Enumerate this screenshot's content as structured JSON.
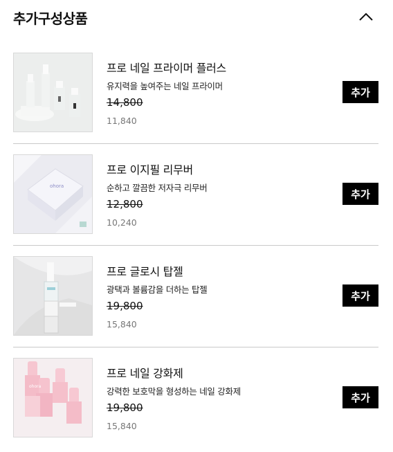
{
  "header": {
    "title": "추가구성상품",
    "toggle_icon": "chevron-up-icon"
  },
  "products": [
    {
      "name": "프로 네일 프라이머 플러스",
      "desc": "유지력을 높여주는 네일 프라이머",
      "original_price": "14,800",
      "sale_price": "11,840",
      "add_label": "추가",
      "image_tone": "#e9ebea"
    },
    {
      "name": "프로 이지필 리무버",
      "desc": "순하고 깔끔한 저자극 리무버",
      "original_price": "12,800",
      "sale_price": "10,240",
      "add_label": "추가",
      "image_tone": "#e6e6ee",
      "image_text": "ohora"
    },
    {
      "name": "프로 글로시 탑젤",
      "desc": "광택과 볼륨감을 더하는 탑젤",
      "original_price": "19,800",
      "sale_price": "15,840",
      "add_label": "추가",
      "image_tone": "#e3e3e4"
    },
    {
      "name": "프로 네일 강화제",
      "desc": "강력한 보호막을 형성하는 네일 강화제",
      "original_price": "19,800",
      "sale_price": "15,840",
      "add_label": "추가",
      "image_tone": "#f4e7ea",
      "image_text": "ohora"
    }
  ]
}
